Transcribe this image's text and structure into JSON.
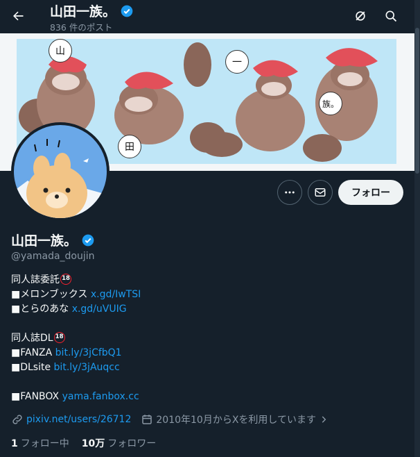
{
  "header": {
    "display_name": "山田一族。",
    "posts_count": "836 件のポスト"
  },
  "profile": {
    "display_name": "山田一族。",
    "handle": "@yamada_doujin",
    "follow_label": "フォロー"
  },
  "banner": {
    "bubbles": [
      "山",
      "一",
      "田",
      "族。"
    ]
  },
  "bio": {
    "line1": "同人誌委託",
    "badge": "18",
    "line2_text": "■メロンブックス ",
    "line2_link": "x.gd/IwTSI",
    "line3_text": "■とらのあな ",
    "line3_link": "x.gd/uVUIG",
    "line4": "同人誌DL",
    "line5_text": "■FANZA ",
    "line5_link": "bit.ly/3jCfbQ1",
    "line6_text": "■DLsite ",
    "line6_link": "bit.ly/3jAuqcc",
    "line7_text": "■FANBOX ",
    "line7_link": "yama.fanbox.cc"
  },
  "meta": {
    "website": "pixiv.net/users/26712",
    "joined": "2010年10月からXを利用しています"
  },
  "stats": {
    "following_count": "1",
    "following_label": "フォロー中",
    "followers_count": "10万",
    "followers_label": "フォロワー"
  },
  "colors": {
    "background": "#15202b",
    "link": "#1d9bf0",
    "verified": "#1d9bf0",
    "secondary_text": "#8b98a5"
  }
}
